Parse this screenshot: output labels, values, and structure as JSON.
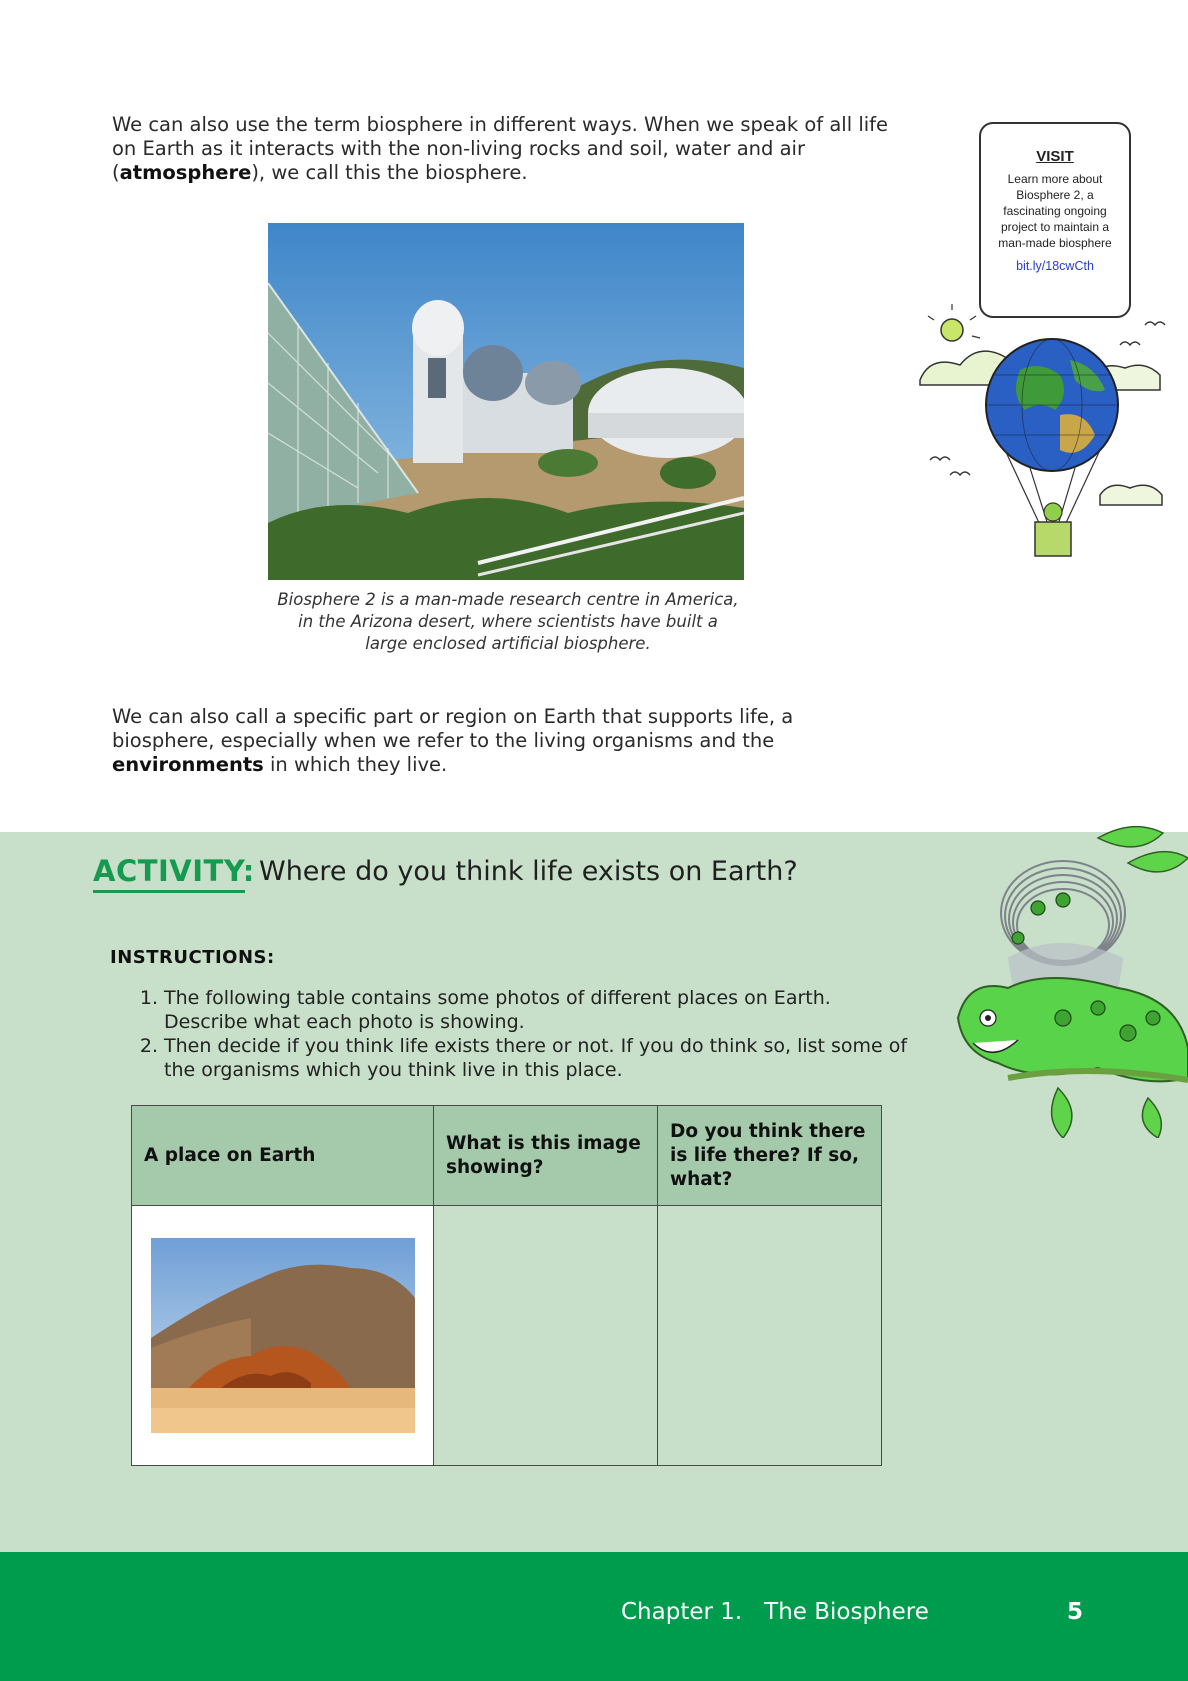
{
  "intro": {
    "p1_before": "We can also use the term biosphere in different ways. When we speak of all life on Earth as it interacts with the non-living rocks and soil, water and air (",
    "p1_bold": "atmosphere",
    "p1_after": "), we call this the biosphere."
  },
  "photo_caption": {
    "line1": "Biosphere 2 is a man-made research centre in America,",
    "line2": "in the Arizona desert, where scientists have built a",
    "line3": "large enclosed artificial biosphere."
  },
  "visit": {
    "title": "VISIT",
    "text": "Learn more about Biosphere 2, a fascinating ongoing project to maintain a man-made biosphere",
    "link": "bit.ly/18cwCth"
  },
  "second_para": {
    "before": "We can also call a specific part or region on Earth that supports life, a biosphere, especially when we refer to the living organisms and the ",
    "bold": "environments",
    "after": " in which they live."
  },
  "activity": {
    "label": "ACTIVITY:",
    "question": "Where do you think life exists on Earth?",
    "instructions_heading": "INSTRUCTIONS:",
    "instructions": [
      {
        "num": "1.",
        "text": "The following table contains some photos of different places on Earth. Describe what each photo is showing."
      },
      {
        "num": "2.",
        "text": "Then decide if you think life exists there or not. If you do think so, list some of the organisms which you think live in this place."
      }
    ],
    "table": {
      "headers": [
        "A place on Earth",
        "What is this image showing?",
        "Do you think there is life there? If so, what?"
      ]
    }
  },
  "footer": {
    "chapter": "Chapter 1.   The Biosphere",
    "page": "5"
  },
  "colors": {
    "green_dark": "#009c4d",
    "green_band": "#c8dfca",
    "green_header": "#a5c9ab",
    "activity_label": "#169a50"
  }
}
